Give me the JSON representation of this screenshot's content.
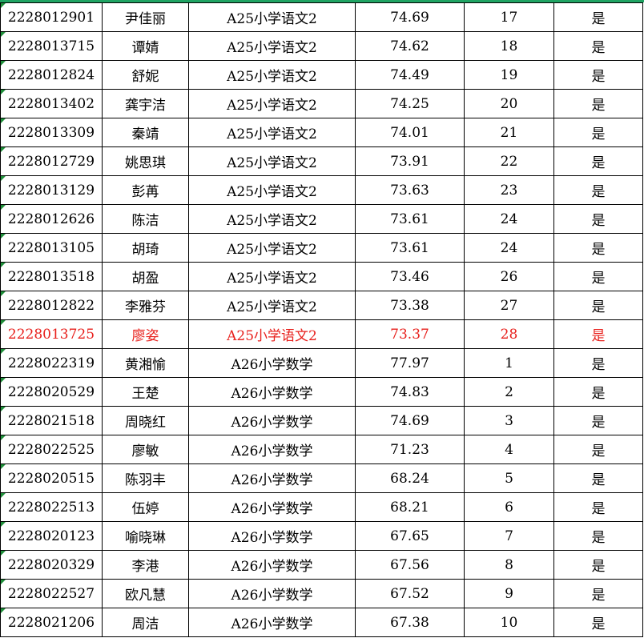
{
  "rows": [
    {
      "id": "2228012901",
      "name": "尹佳丽",
      "position": "A25小学语文2",
      "score": "74.69",
      "rank": "17",
      "qualified": "是",
      "highlight": false
    },
    {
      "id": "2228013715",
      "name": "谭婧",
      "position": "A25小学语文2",
      "score": "74.62",
      "rank": "18",
      "qualified": "是",
      "highlight": false
    },
    {
      "id": "2228012824",
      "name": "舒妮",
      "position": "A25小学语文2",
      "score": "74.49",
      "rank": "19",
      "qualified": "是",
      "highlight": false
    },
    {
      "id": "2228013402",
      "name": "龚宇洁",
      "position": "A25小学语文2",
      "score": "74.25",
      "rank": "20",
      "qualified": "是",
      "highlight": false
    },
    {
      "id": "2228013309",
      "name": "秦靖",
      "position": "A25小学语文2",
      "score": "74.01",
      "rank": "21",
      "qualified": "是",
      "highlight": false
    },
    {
      "id": "2228012729",
      "name": "姚思琪",
      "position": "A25小学语文2",
      "score": "73.91",
      "rank": "22",
      "qualified": "是",
      "highlight": false
    },
    {
      "id": "2228013129",
      "name": "彭苒",
      "position": "A25小学语文2",
      "score": "73.63",
      "rank": "23",
      "qualified": "是",
      "highlight": false
    },
    {
      "id": "2228012626",
      "name": "陈洁",
      "position": "A25小学语文2",
      "score": "73.61",
      "rank": "24",
      "qualified": "是",
      "highlight": false
    },
    {
      "id": "2228013105",
      "name": "胡琦",
      "position": "A25小学语文2",
      "score": "73.61",
      "rank": "24",
      "qualified": "是",
      "highlight": false
    },
    {
      "id": "2228013518",
      "name": "胡盈",
      "position": "A25小学语文2",
      "score": "73.46",
      "rank": "26",
      "qualified": "是",
      "highlight": false
    },
    {
      "id": "2228012822",
      "name": "李雅芬",
      "position": "A25小学语文2",
      "score": "73.38",
      "rank": "27",
      "qualified": "是",
      "highlight": false
    },
    {
      "id": "2228013725",
      "name": "廖姿",
      "position": "A25小学语文2",
      "score": "73.37",
      "rank": "28",
      "qualified": "是",
      "highlight": true
    },
    {
      "id": "2228022319",
      "name": "黄湘愉",
      "position": "A26小学数学",
      "score": "77.97",
      "rank": "1",
      "qualified": "是",
      "highlight": false
    },
    {
      "id": "2228020529",
      "name": "王楚",
      "position": "A26小学数学",
      "score": "74.83",
      "rank": "2",
      "qualified": "是",
      "highlight": false
    },
    {
      "id": "2228021518",
      "name": "周晓红",
      "position": "A26小学数学",
      "score": "74.69",
      "rank": "3",
      "qualified": "是",
      "highlight": false
    },
    {
      "id": "2228022525",
      "name": "廖敏",
      "position": "A26小学数学",
      "score": "71.23",
      "rank": "4",
      "qualified": "是",
      "highlight": false
    },
    {
      "id": "2228020515",
      "name": "陈羽丰",
      "position": "A26小学数学",
      "score": "68.24",
      "rank": "5",
      "qualified": "是",
      "highlight": false
    },
    {
      "id": "2228022513",
      "name": "伍婷",
      "position": "A26小学数学",
      "score": "68.21",
      "rank": "6",
      "qualified": "是",
      "highlight": false
    },
    {
      "id": "2228020123",
      "name": "喻晓琳",
      "position": "A26小学数学",
      "score": "67.65",
      "rank": "7",
      "qualified": "是",
      "highlight": false
    },
    {
      "id": "2228020329",
      "name": "李港",
      "position": "A26小学数学",
      "score": "67.56",
      "rank": "8",
      "qualified": "是",
      "highlight": false
    },
    {
      "id": "2228022527",
      "name": "欧凡慧",
      "position": "A26小学数学",
      "score": "67.52",
      "rank": "9",
      "qualified": "是",
      "highlight": false
    },
    {
      "id": "2228021206",
      "name": "周洁",
      "position": "A26小学数学",
      "score": "67.38",
      "rank": "10",
      "qualified": "是",
      "highlight": false
    }
  ],
  "colors": {
    "highlight_text": "#e8201c",
    "top_border": "#1fa463",
    "cell_marker": "#1f8f3a"
  }
}
